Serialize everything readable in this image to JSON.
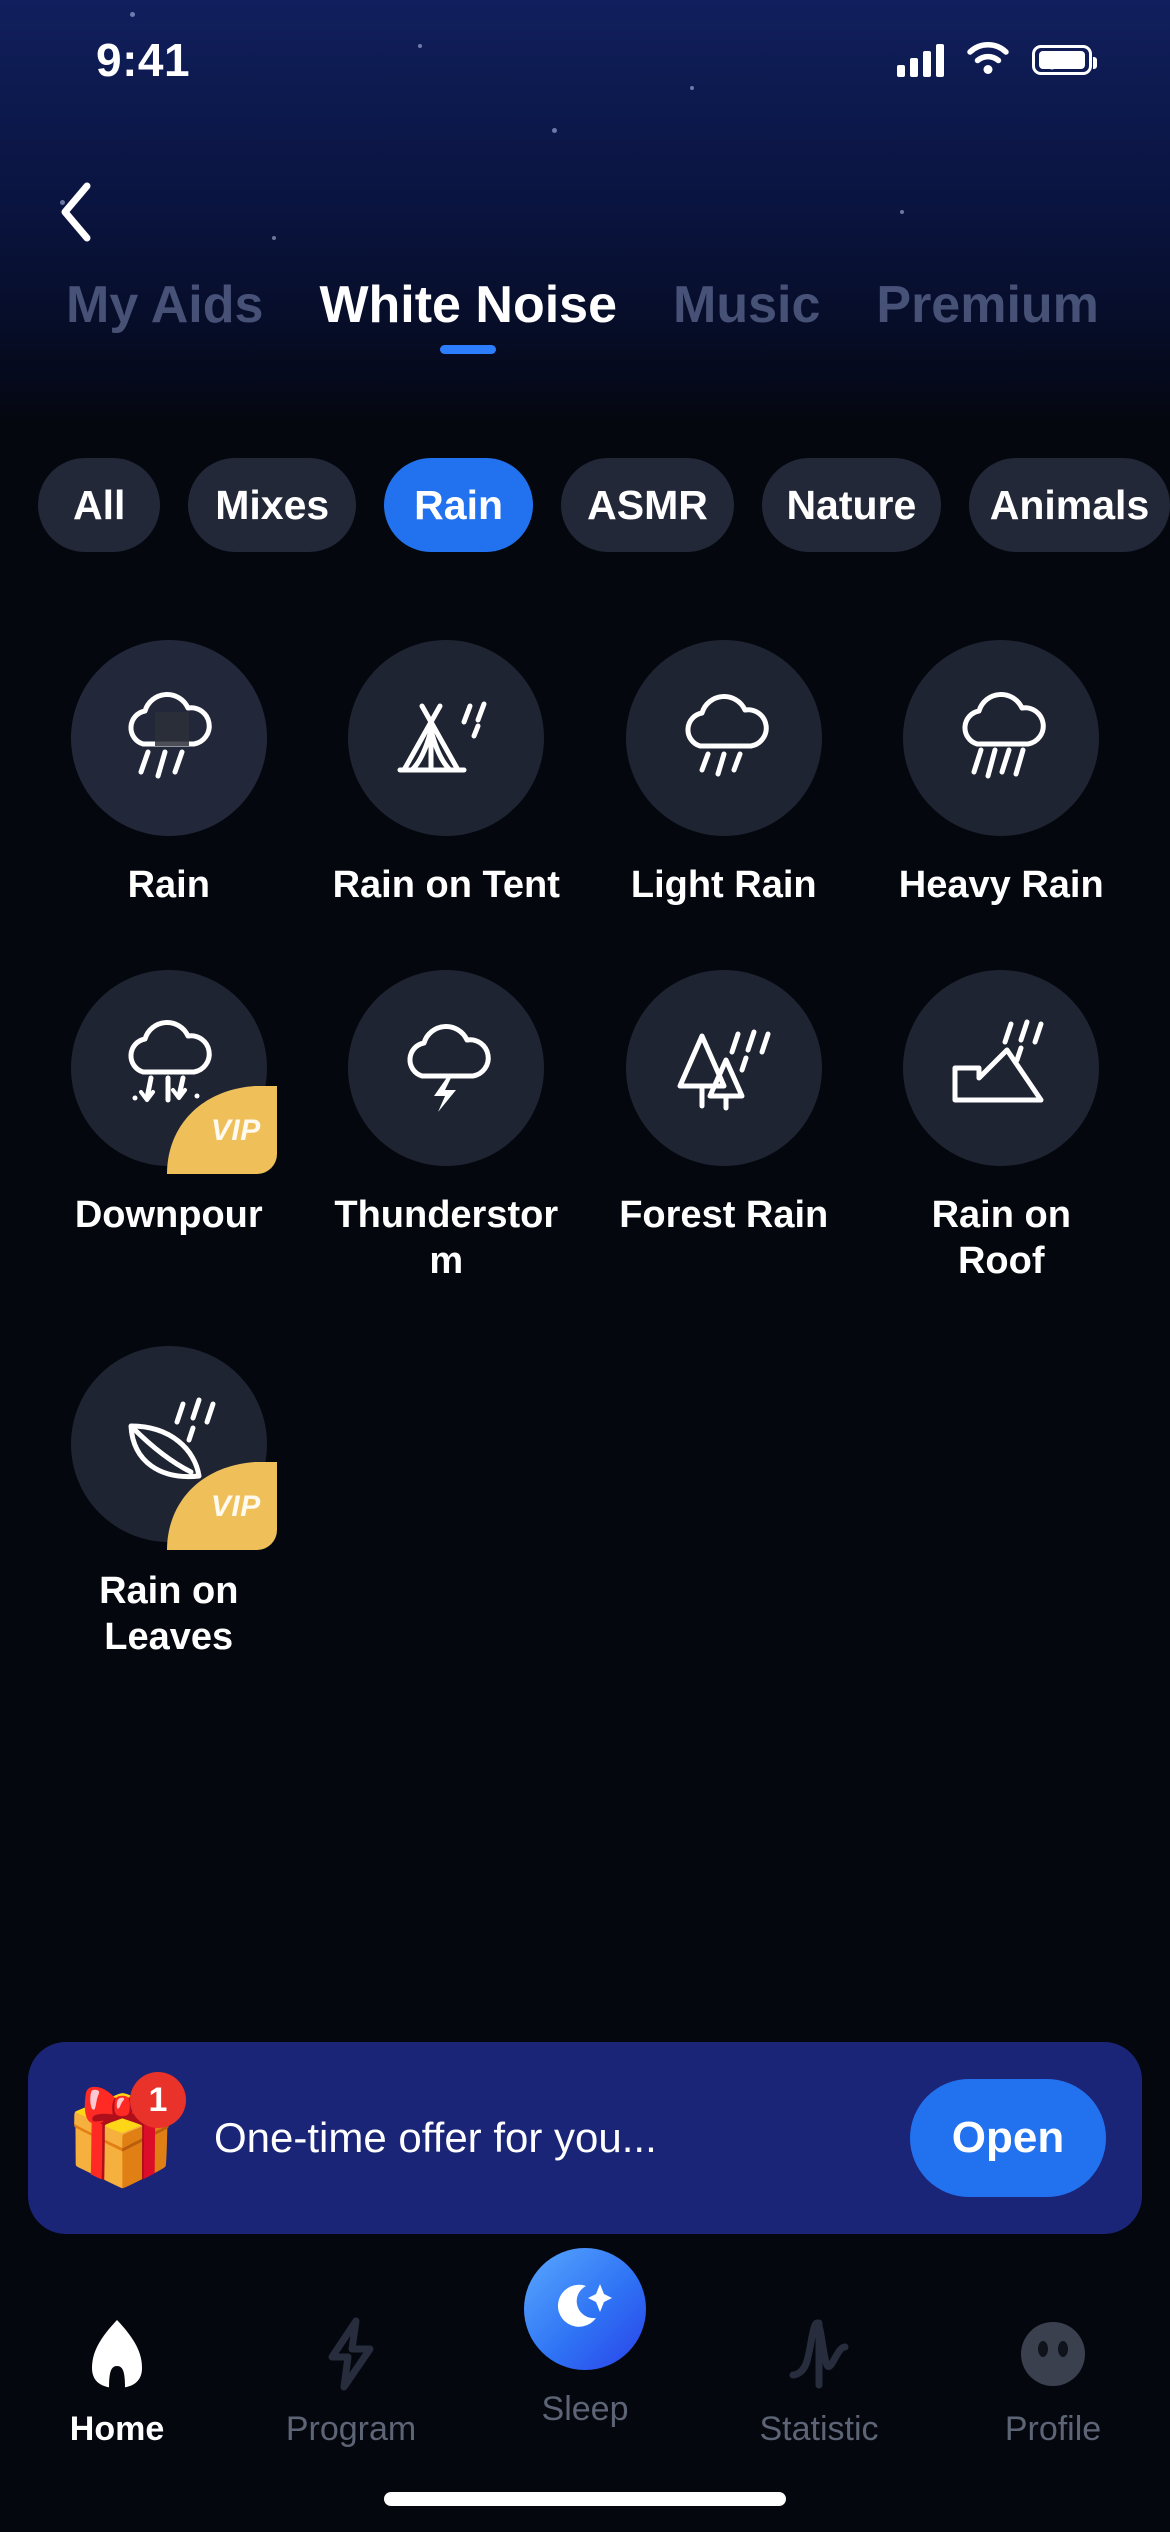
{
  "status_bar": {
    "time": "9:41",
    "cellular_icon": "cellular-signal-icon",
    "wifi_icon": "wifi-icon",
    "battery_icon": "battery-full-icon"
  },
  "header": {
    "back_icon": "chevron-left-icon",
    "tabs": [
      {
        "label": "My Aids",
        "active": false
      },
      {
        "label": "White Noise",
        "active": true
      },
      {
        "label": "Music",
        "active": false
      },
      {
        "label": "Premium",
        "active": false
      }
    ]
  },
  "filters": {
    "chips": [
      {
        "label": "All",
        "active": false
      },
      {
        "label": "Mixes",
        "active": false
      },
      {
        "label": "Rain",
        "active": true
      },
      {
        "label": "ASMR",
        "active": false
      },
      {
        "label": "Nature",
        "active": false
      },
      {
        "label": "Animals",
        "active": false
      }
    ]
  },
  "sounds": {
    "vip_badge_label": "VIP",
    "items": [
      {
        "label": "Rain",
        "icon": "rain-cloud-icon",
        "vip": false,
        "playing": true
      },
      {
        "label": "Rain on Tent",
        "icon": "tent-rain-icon",
        "vip": false,
        "playing": false
      },
      {
        "label": "Light Rain",
        "icon": "light-rain-cloud-icon",
        "vip": false,
        "playing": false
      },
      {
        "label": "Heavy Rain",
        "icon": "heavy-rain-cloud-icon",
        "vip": false,
        "playing": false
      },
      {
        "label": "Downpour",
        "icon": "downpour-cloud-icon",
        "vip": true,
        "playing": false
      },
      {
        "label": "Thunderstorm",
        "icon": "thunderstorm-cloud-icon",
        "vip": false,
        "playing": false
      },
      {
        "label": "Forest Rain",
        "icon": "forest-rain-icon",
        "vip": false,
        "playing": false
      },
      {
        "label": "Rain on Roof",
        "icon": "roof-rain-icon",
        "vip": false,
        "playing": false
      },
      {
        "label": "Rain on Leaves",
        "icon": "leaf-rain-icon",
        "vip": true,
        "playing": false
      }
    ]
  },
  "offer_banner": {
    "gift_icon": "gift-box-icon",
    "badge_count": "1",
    "text": "One-time offer for you...",
    "button_label": "Open"
  },
  "bottom_nav": {
    "items": [
      {
        "label": "Home",
        "icon": "home-icon",
        "active": true
      },
      {
        "label": "Program",
        "icon": "lightning-bolt-icon",
        "active": false
      },
      {
        "label": "Sleep",
        "icon": "moon-star-icon",
        "active": false
      },
      {
        "label": "Statistic",
        "icon": "pulse-wave-icon",
        "active": false
      },
      {
        "label": "Profile",
        "icon": "face-avatar-icon",
        "active": false
      }
    ]
  },
  "colors": {
    "accent_blue": "#2272f0",
    "vip_gold": "#efc05a",
    "background": "#05070f",
    "header_blue": "#111f5e",
    "banner_blue": "#1b2577",
    "badge_red": "#e8322a"
  }
}
